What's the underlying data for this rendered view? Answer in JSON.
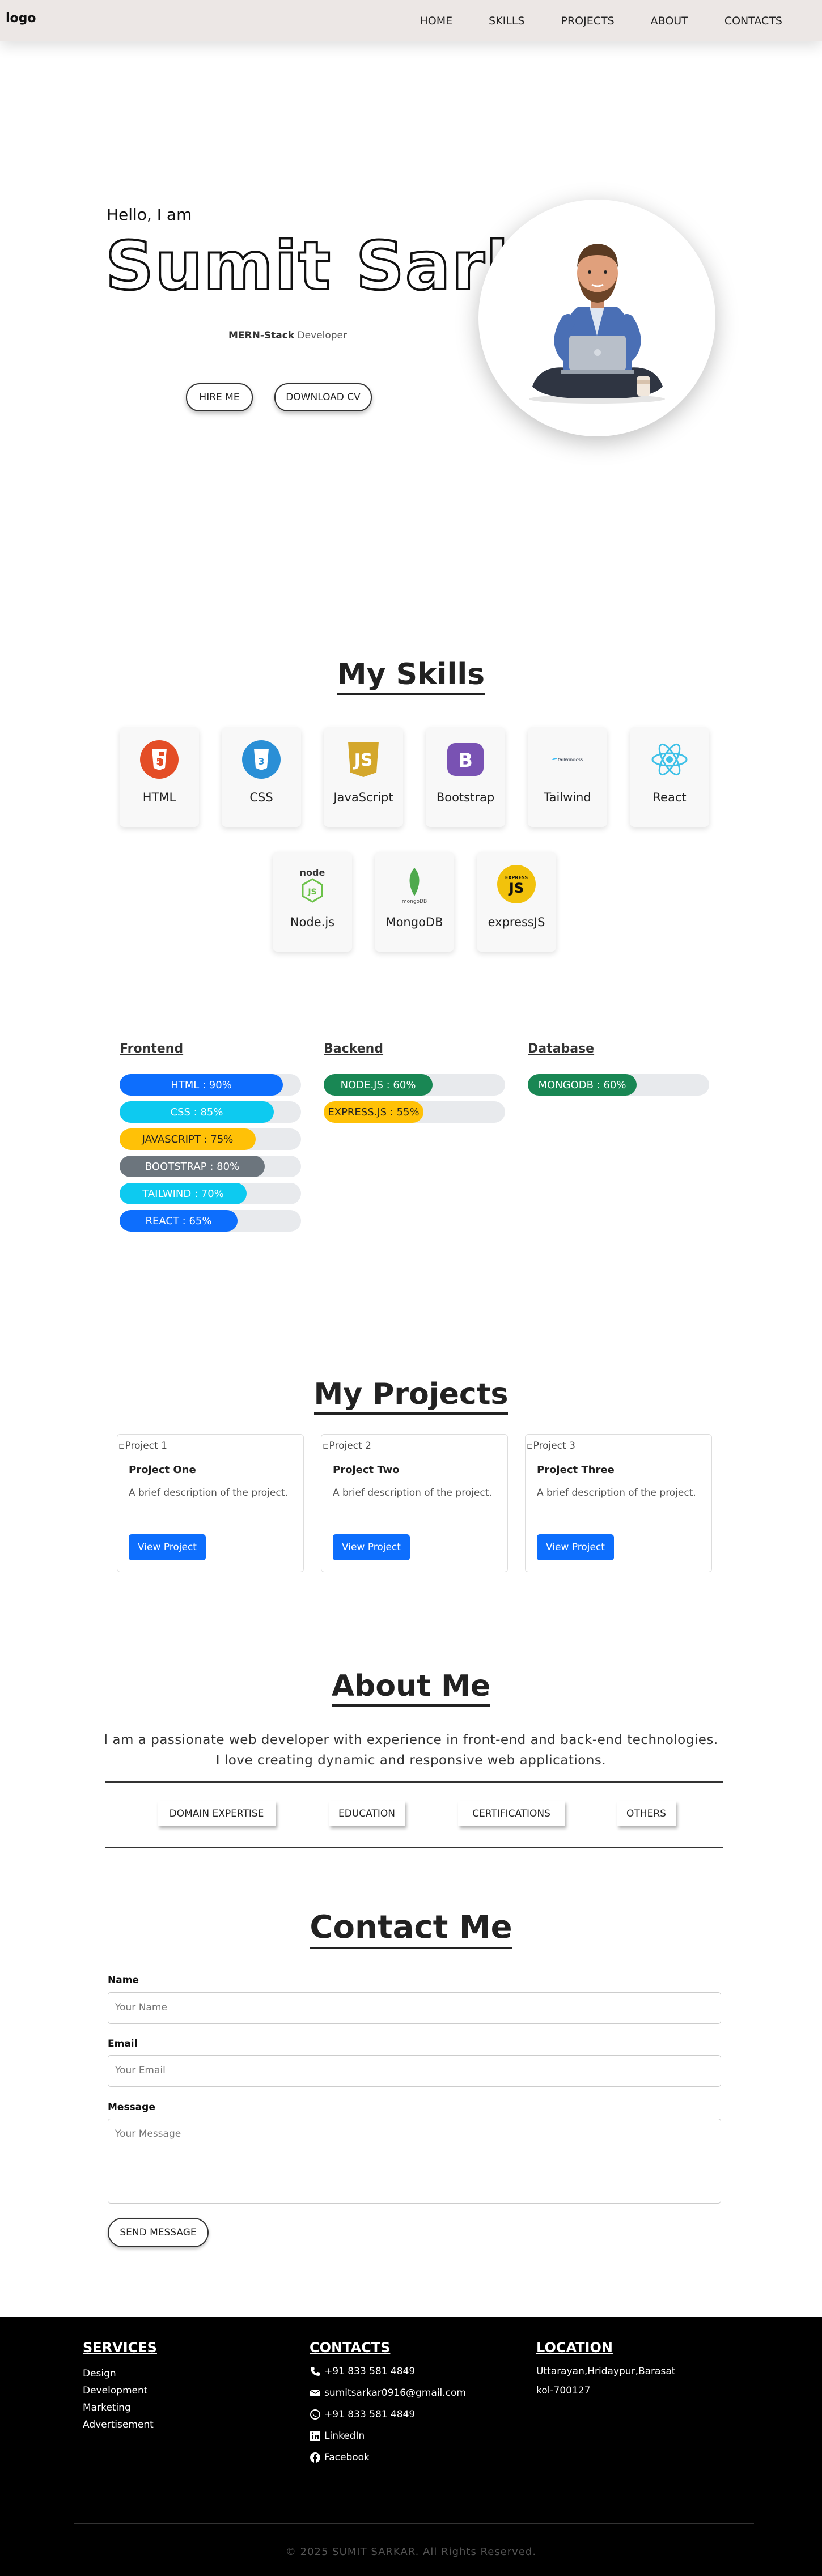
{
  "nav": {
    "logo": "logo",
    "items": [
      "HOME",
      "SKILLS",
      "PROJECTS",
      "ABOUT",
      "CONTACTS"
    ]
  },
  "hero": {
    "greeting": "Hello, I am",
    "name": "Sumit Sarkar",
    "role_bold": "MERN-Stack",
    "role_rest": " Developer",
    "hire_label": "HIRE ME",
    "cv_label": "DOWNLOAD CV"
  },
  "skills": {
    "title": "My Skills",
    "cards": [
      {
        "label": "HTML",
        "icon": "html5-icon"
      },
      {
        "label": "CSS",
        "icon": "css3-icon"
      },
      {
        "label": "JavaScript",
        "icon": "javascript-icon"
      },
      {
        "label": "Bootstrap",
        "icon": "bootstrap-icon"
      },
      {
        "label": "Tailwind",
        "icon": "tailwind-icon",
        "icon_text": "tailwindcss"
      },
      {
        "label": "React",
        "icon": "react-icon"
      },
      {
        "label": "Node.js",
        "icon": "nodejs-icon",
        "icon_text": "node"
      },
      {
        "label": "MongoDB",
        "icon": "mongodb-icon",
        "icon_text": "mongoDB"
      },
      {
        "label": "expressJS",
        "icon": "expressjs-icon",
        "icon_text": "EXPRESS"
      }
    ],
    "categories": [
      {
        "title": "Frontend",
        "bars": [
          {
            "label": "HTML : 90%",
            "value": 90,
            "color": "#0d6efd"
          },
          {
            "label": "CSS : 85%",
            "value": 85,
            "color": "#0dcaf0"
          },
          {
            "label": "JAVASCRIPT : 75%",
            "value": 75,
            "color": "#ffc107"
          },
          {
            "label": "BOOTSTRAP : 80%",
            "value": 80,
            "color": "#6c757d"
          },
          {
            "label": "TAILWIND : 70%",
            "value": 70,
            "color": "#0dcaf0"
          },
          {
            "label": "REACT : 65%",
            "value": 65,
            "color": "#0d6efd"
          }
        ]
      },
      {
        "title": "Backend",
        "bars": [
          {
            "label": "NODE.JS : 60%",
            "value": 60,
            "color": "#198754"
          },
          {
            "label": "EXPRESS.JS : 55%",
            "value": 55,
            "color": "#ffc107"
          }
        ]
      },
      {
        "title": "Database",
        "bars": [
          {
            "label": "MONGODB : 60%",
            "value": 60,
            "color": "#198754"
          }
        ]
      }
    ]
  },
  "projects": {
    "title": "My Projects",
    "items": [
      {
        "img_alt": "Project 1",
        "title": "Project One",
        "desc": "A brief description of the project.",
        "button": "View Project"
      },
      {
        "img_alt": "Project 2",
        "title": "Project Two",
        "desc": "A brief description of the project.",
        "button": "View Project"
      },
      {
        "img_alt": "Project 3",
        "title": "Project Three",
        "desc": "A brief description of the project.",
        "button": "View Project"
      }
    ]
  },
  "about": {
    "title": "About Me",
    "text": "I am a passionate web developer with experience in front-end and back-end technologies. I love creating dynamic and responsive web applications.",
    "tabs": [
      "DOMAIN EXPERTISE",
      "EDUCATION",
      "CERTIFICATIONS",
      "OTHERS"
    ]
  },
  "contact": {
    "title": "Contact Me",
    "name_label": "Name",
    "name_placeholder": "Your Name",
    "email_label": "Email",
    "email_placeholder": "Your Email",
    "message_label": "Message",
    "message_placeholder": "Your Message",
    "send_label": "SEND MESSAGE"
  },
  "footer": {
    "services_title": "SERVICES",
    "services": [
      "Design",
      "Development",
      "Marketing",
      "Advertisement"
    ],
    "contacts_title": "CONTACTS",
    "phone": "+91 833 581 4849",
    "email": "sumitsarkar0916@gmail.com",
    "whatsapp": "+91 833 581 4849",
    "linkedin": "LinkedIn",
    "facebook": "Facebook",
    "location_title": "LOCATION",
    "location_line1": "Uttarayan,Hridaypur,Barasat",
    "location_line2": "kol-700127",
    "copyright": "© 2025 SUMIT SARKAR. All Rights Reserved."
  }
}
